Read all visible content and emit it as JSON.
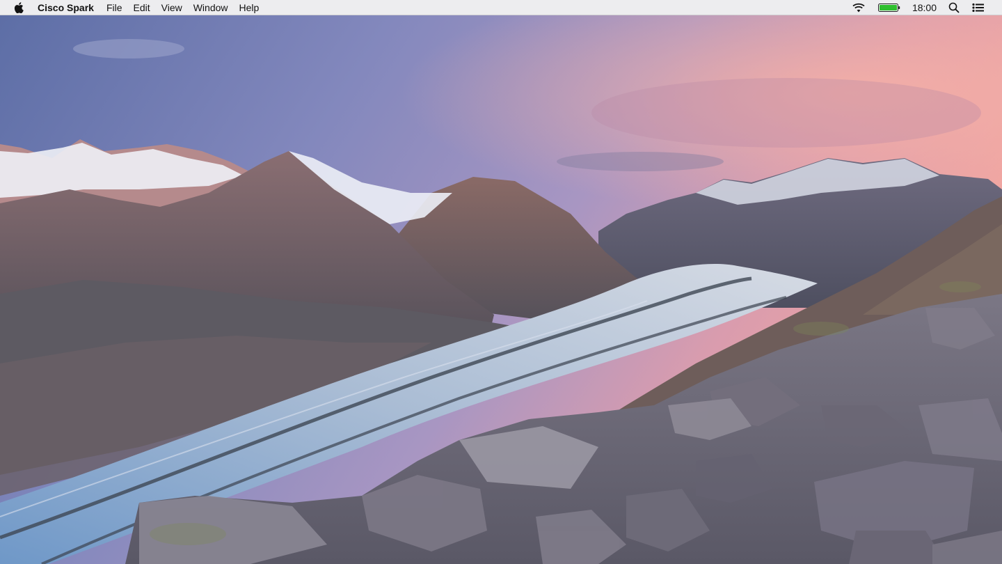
{
  "menubar": {
    "apple_icon": "apple-logo-icon",
    "app_name": "Cisco Spark",
    "menus": [
      "File",
      "Edit",
      "View",
      "Window",
      "Help"
    ],
    "status": {
      "wifi_icon": "wifi-icon",
      "battery_icon": "battery-icon",
      "battery_color": "#2fbf2f",
      "clock": "18:00",
      "search_icon": "spotlight-search-icon",
      "notification_icon": "notification-center-icon"
    }
  },
  "desktop": {
    "wallpaper": "glacier-mountain-landscape",
    "colors": {
      "sky_top": "#7a86b8",
      "sky_pink": "#e8a0a8",
      "glacier": "#b8c8dc",
      "rock": "#6e6e78"
    }
  }
}
